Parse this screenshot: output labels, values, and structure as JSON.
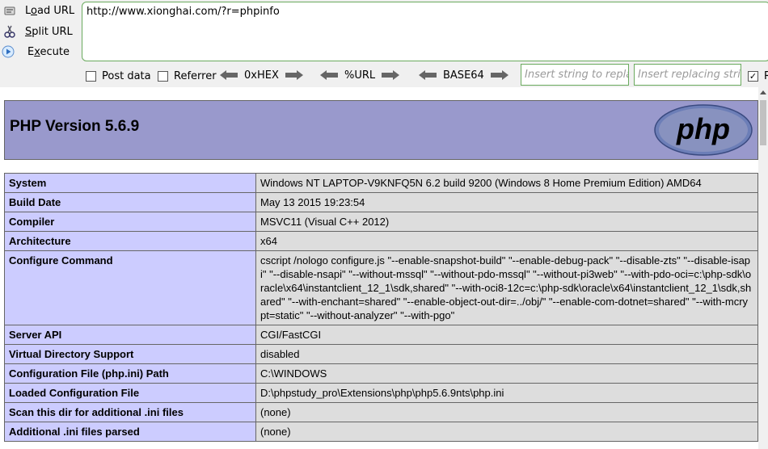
{
  "hackbar": {
    "load_url": "Load URL",
    "split_url": "Split URL",
    "execute": "Execute",
    "url_value": "http://www.xionghai.com/?r=phpinfo",
    "post_data": "Post data",
    "referrer": "Referrer",
    "hex": "0xHEX",
    "url_enc": "%URL",
    "base64": "BASE64",
    "insert_placeholder": "Insert string to replace",
    "replacing_placeholder": "Insert replacing string",
    "last_check_label": "R"
  },
  "page": {
    "title": "PHP Version 5.6.9",
    "logo_text": "php",
    "rows": [
      {
        "key": "System",
        "value": "Windows NT LAPTOP-V9KNFQ5N 6.2 build 9200 (Windows 8 Home Premium Edition) AMD64"
      },
      {
        "key": "Build Date",
        "value": "May 13 2015 19:23:54"
      },
      {
        "key": "Compiler",
        "value": "MSVC11 (Visual C++ 2012)"
      },
      {
        "key": "Architecture",
        "value": "x64"
      },
      {
        "key": "Configure Command",
        "value": "cscript /nologo configure.js \"--enable-snapshot-build\" \"--enable-debug-pack\" \"--disable-zts\" \"--disable-isapi\" \"--disable-nsapi\" \"--without-mssql\" \"--without-pdo-mssql\" \"--without-pi3web\" \"--with-pdo-oci=c:\\php-sdk\\oracle\\x64\\instantclient_12_1\\sdk,shared\" \"--with-oci8-12c=c:\\php-sdk\\oracle\\x64\\instantclient_12_1\\sdk,shared\" \"--with-enchant=shared\" \"--enable-object-out-dir=../obj/\" \"--enable-com-dotnet=shared\" \"--with-mcrypt=static\" \"--without-analyzer\" \"--with-pgo\""
      },
      {
        "key": "Server API",
        "value": "CGI/FastCGI"
      },
      {
        "key": "Virtual Directory Support",
        "value": "disabled"
      },
      {
        "key": "Configuration File (php.ini) Path",
        "value": "C:\\WINDOWS"
      },
      {
        "key": "Loaded Configuration File",
        "value": "D:\\phpstudy_pro\\Extensions\\php\\php5.6.9nts\\php.ini"
      },
      {
        "key": "Scan this dir for additional .ini files",
        "value": "(none)"
      },
      {
        "key": "Additional .ini files parsed",
        "value": "(none)"
      }
    ]
  },
  "colors": {
    "header_bg": "#9999cc",
    "key_bg": "#ccccff",
    "value_bg": "#dddddd",
    "hackbar_border": "#6aaa5e"
  }
}
